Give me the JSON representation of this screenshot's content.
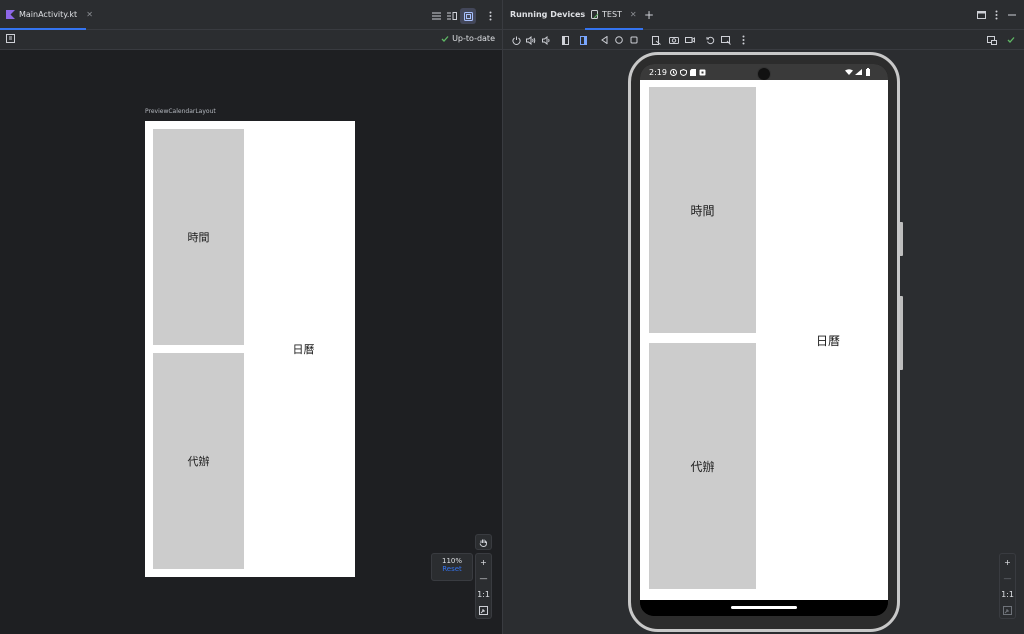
{
  "colors": {
    "accent": "#3574f0",
    "success": "#5fb865",
    "editor_bg": "#1e1f22",
    "panel_bg": "#2b2d30",
    "placeholder": "#cccccc"
  },
  "editor": {
    "tab": {
      "label": "MainActivity.kt",
      "icon": "kotlin-file-icon"
    },
    "status": "Up-to-date",
    "preview": {
      "label": "PreviewCalendarLayout",
      "time_label": "時間",
      "todo_label": "代辦",
      "calendar_label": "日曆"
    },
    "zoom": {
      "value": "110%",
      "reset": "Reset",
      "zoom_in": "+",
      "zoom_out": "—",
      "actual_size": "1:1"
    }
  },
  "running_devices": {
    "title": "Running Devices",
    "device_tab": "TEST",
    "add_tab": "+",
    "device_zoom": {
      "zoom_in": "+",
      "zoom_out": "—",
      "actual_size": "1:1"
    },
    "status_bar": {
      "time": "2:19"
    },
    "app": {
      "time_label": "時間",
      "todo_label": "代辦",
      "calendar_label": "日曆"
    }
  }
}
